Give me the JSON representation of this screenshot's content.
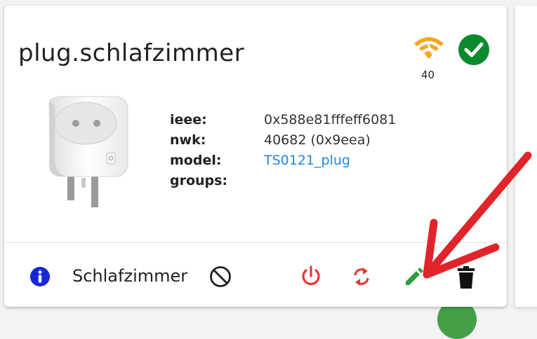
{
  "device": {
    "friendly_name": "plug.schlafzimmer",
    "link_quality": "40",
    "status_icon": "check-circle-icon",
    "signal_icon": "wifi-weak-icon",
    "image_alt": "smart-plug-image"
  },
  "details": {
    "ieee_label": "ieee:",
    "ieee_value": "0x588e81fffeff6081",
    "nwk_label": "nwk:",
    "nwk_value": "40682 (0x9eea)",
    "model_label": "model:",
    "model_value": "TS0121_plug",
    "groups_label": "groups:",
    "groups_value": ""
  },
  "footer": {
    "room": "Schlafzimmer",
    "actions": [
      "power-icon",
      "sync-icon",
      "edit-icon",
      "delete-icon"
    ]
  },
  "colors": {
    "signal": "#f5a623",
    "ok": "#0b8a2c",
    "danger": "#e53935",
    "edit": "#2e9c3a",
    "link": "#1e88e5",
    "info": "#1628d6",
    "annotation_arrow": "#e0242a"
  }
}
